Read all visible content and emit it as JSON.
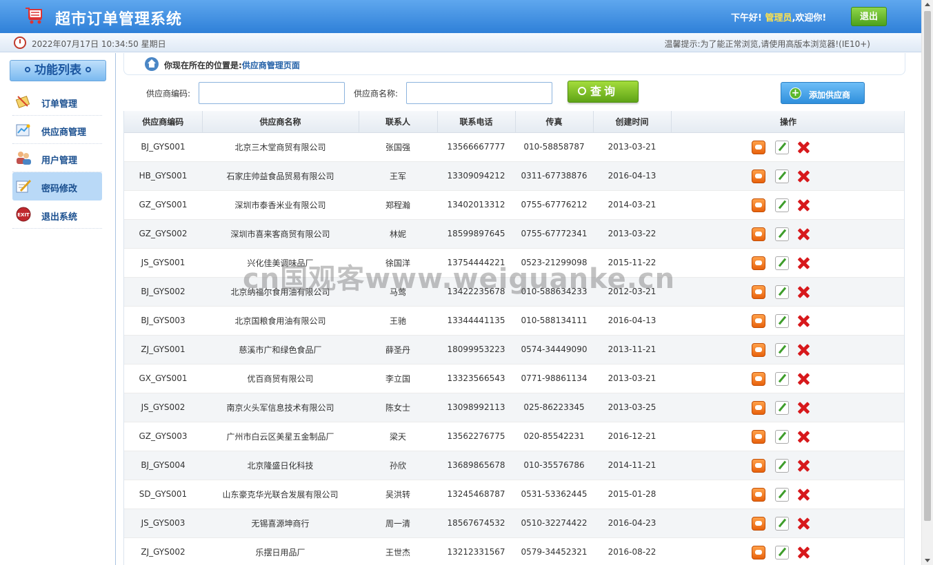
{
  "header": {
    "title": "超市订单管理系统",
    "greeting": "下午好!",
    "role": "管理员",
    "welcome": ",欢迎你!",
    "logout_label": "退出"
  },
  "infobar": {
    "datetime": "2022年07月17日 10:34:50 星期日",
    "tip": "温馨提示:为了能正常浏览,请使用高版本浏览器!(IE10+)"
  },
  "sidebar": {
    "title": "功能列表",
    "items": [
      {
        "label": "订单管理",
        "icon": "order-icon"
      },
      {
        "label": "供应商管理",
        "icon": "supplier-icon"
      },
      {
        "label": "用户管理",
        "icon": "users-icon"
      },
      {
        "label": "密码修改",
        "icon": "password-icon",
        "active": true
      },
      {
        "label": "退出系统",
        "icon": "exit-icon"
      }
    ]
  },
  "breadcrumb": {
    "prefix": "你现在所在的位置是:",
    "page": "供应商管理页面"
  },
  "search": {
    "code_label": "供应商编码:",
    "code_value": "",
    "name_label": "供应商名称:",
    "name_value": "",
    "query_label": "查询",
    "add_label": "添加供应商"
  },
  "table": {
    "headers": [
      "供应商编码",
      "供应商名称",
      "联系人",
      "联系电话",
      "传真",
      "创建时间",
      "操作"
    ],
    "rows": [
      [
        "BJ_GYS001",
        "北京三木堂商贸有限公司",
        "张国强",
        "13566667777",
        "010-58858787",
        "2013-03-21"
      ],
      [
        "HB_GYS001",
        "石家庄帅益食品贸易有限公司",
        "王军",
        "13309094212",
        "0311-67738876",
        "2016-04-13"
      ],
      [
        "GZ_GYS001",
        "深圳市泰香米业有限公司",
        "郑程瀚",
        "13402013312",
        "0755-67776212",
        "2014-03-21"
      ],
      [
        "GZ_GYS002",
        "深圳市喜来客商贸有限公司",
        "林妮",
        "18599897645",
        "0755-67772341",
        "2013-03-22"
      ],
      [
        "JS_GYS001",
        "兴化佳美调味品厂",
        "徐国洋",
        "13754444221",
        "0523-21299098",
        "2015-11-22"
      ],
      [
        "BJ_GYS002",
        "北京纳福尔食用油有限公司",
        "马莺",
        "13422235678",
        "010-588634233",
        "2012-03-21"
      ],
      [
        "BJ_GYS003",
        "北京国粮食用油有限公司",
        "王驰",
        "13344441135",
        "010-588134111",
        "2016-04-13"
      ],
      [
        "ZJ_GYS001",
        "慈溪市广和绿色食品厂",
        "薛圣丹",
        "18099953223",
        "0574-34449090",
        "2013-11-21"
      ],
      [
        "GX_GYS001",
        "优百商贸有限公司",
        "李立国",
        "13323566543",
        "0771-98861134",
        "2013-03-21"
      ],
      [
        "JS_GYS002",
        "南京火头军信息技术有限公司",
        "陈女士",
        "13098992113",
        "025-86223345",
        "2013-03-25"
      ],
      [
        "GZ_GYS003",
        "广州市白云区美星五金制品厂",
        "梁天",
        "13562276775",
        "020-85542231",
        "2016-12-21"
      ],
      [
        "BJ_GYS004",
        "北京隆盛日化科技",
        "孙欣",
        "13689865678",
        "010-35576786",
        "2014-11-21"
      ],
      [
        "SD_GYS001",
        "山东豪克华光联合发展有限公司",
        "吴洪转",
        "13245468787",
        "0531-53362445",
        "2015-01-28"
      ],
      [
        "JS_GYS003",
        "无锡喜源坤商行",
        "周一清",
        "18567674532",
        "0510-32274422",
        "2016-04-23"
      ],
      [
        "ZJ_GYS002",
        "乐摆日用品厂",
        "王世杰",
        "13212331567",
        "0579-34452321",
        "2016-08-22"
      ]
    ]
  },
  "watermark": "cn国观客www.weiguanke.cn",
  "colors": {
    "header_blue": "#2f80d8",
    "accent_green": "#5fa417",
    "link_blue": "#2361a8",
    "delete_red": "#d7191c",
    "view_orange": "#e8620d"
  }
}
